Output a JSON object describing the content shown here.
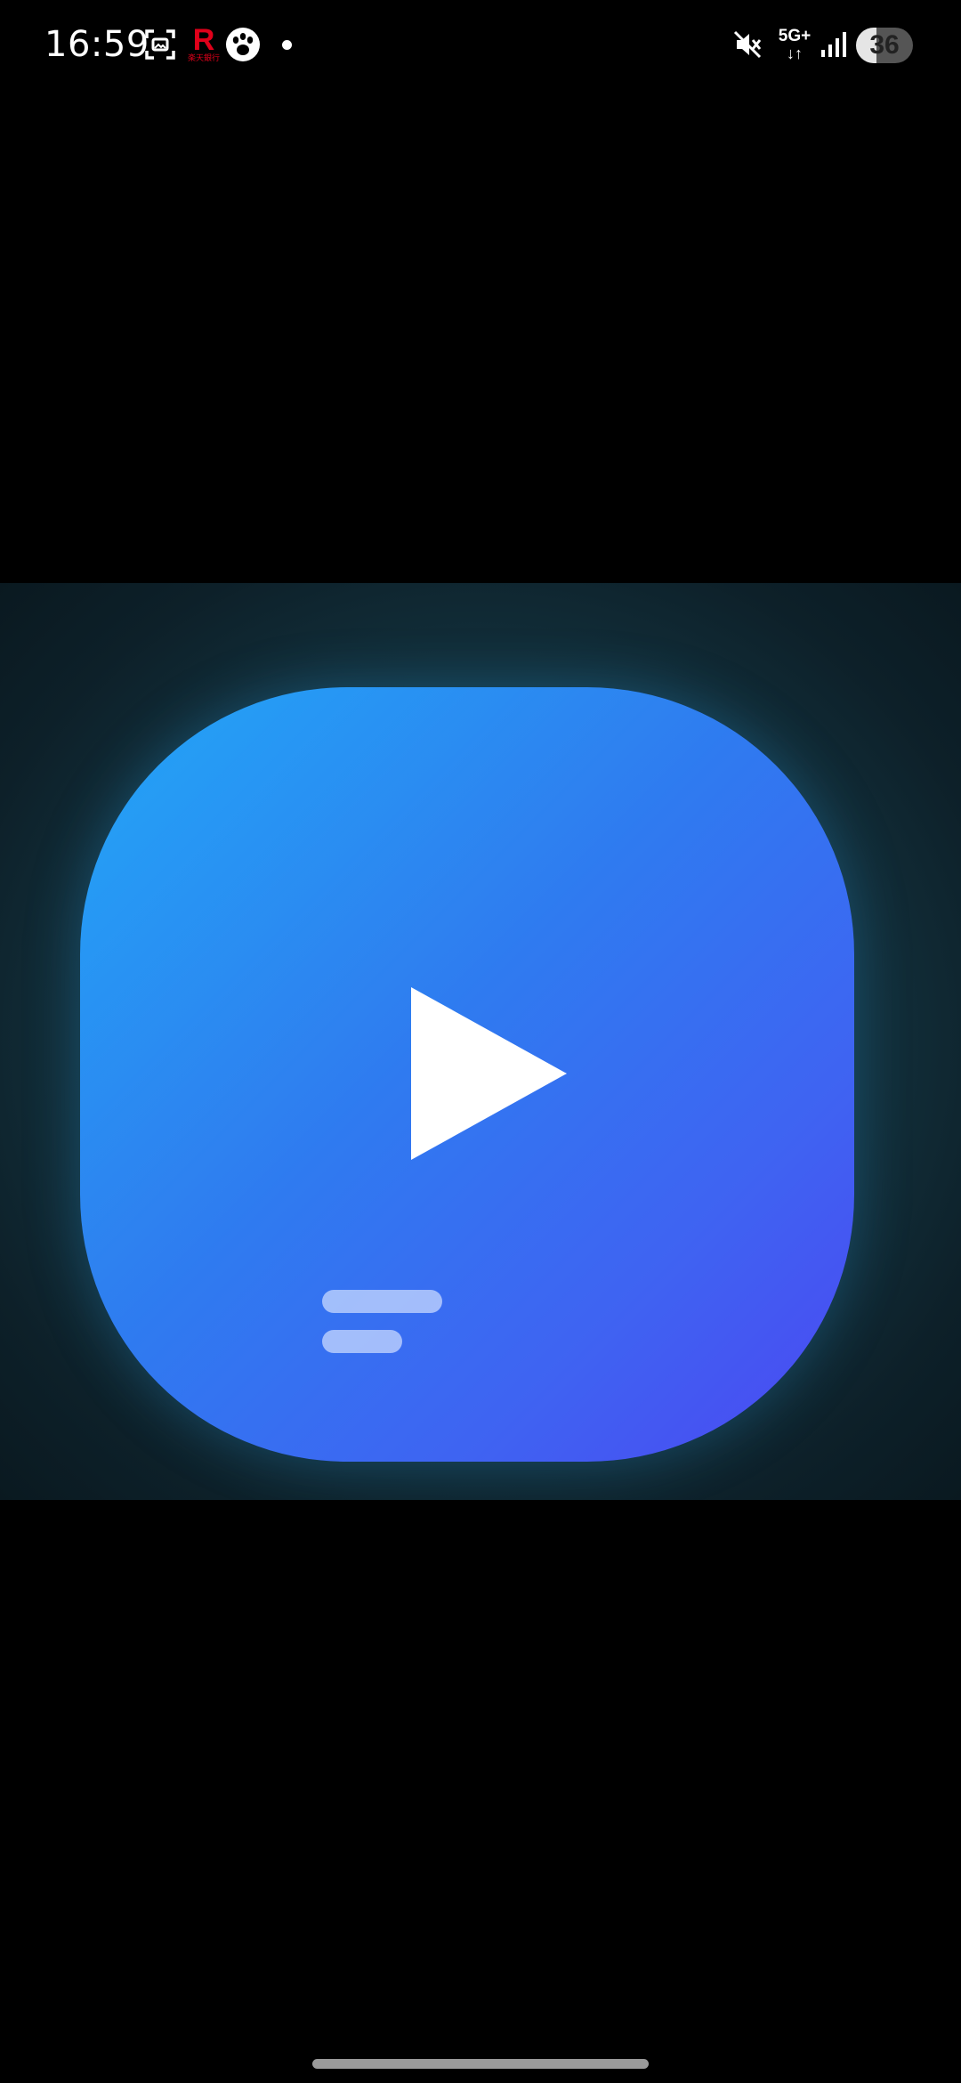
{
  "status_bar": {
    "time": "16:59",
    "rakuten_letter": "R",
    "rakuten_sub": "楽天銀行",
    "network_type": "5G+",
    "network_arrows": "↓↑",
    "battery_level": "36",
    "battery_fraction": 0.36,
    "icons": [
      "screenshot-icon",
      "rakuten-icon",
      "paw-icon",
      "notification-dot-icon",
      "mute-icon",
      "network-icon",
      "signal-icon",
      "battery-icon"
    ]
  },
  "viewer": {
    "image_icon": "media-player-app-icon",
    "colors": {
      "tile_start": "#0a9cf5",
      "tile_end": "#4b47f3",
      "background_center": "#1f4d5d",
      "background_edge": "#0a1920"
    }
  }
}
